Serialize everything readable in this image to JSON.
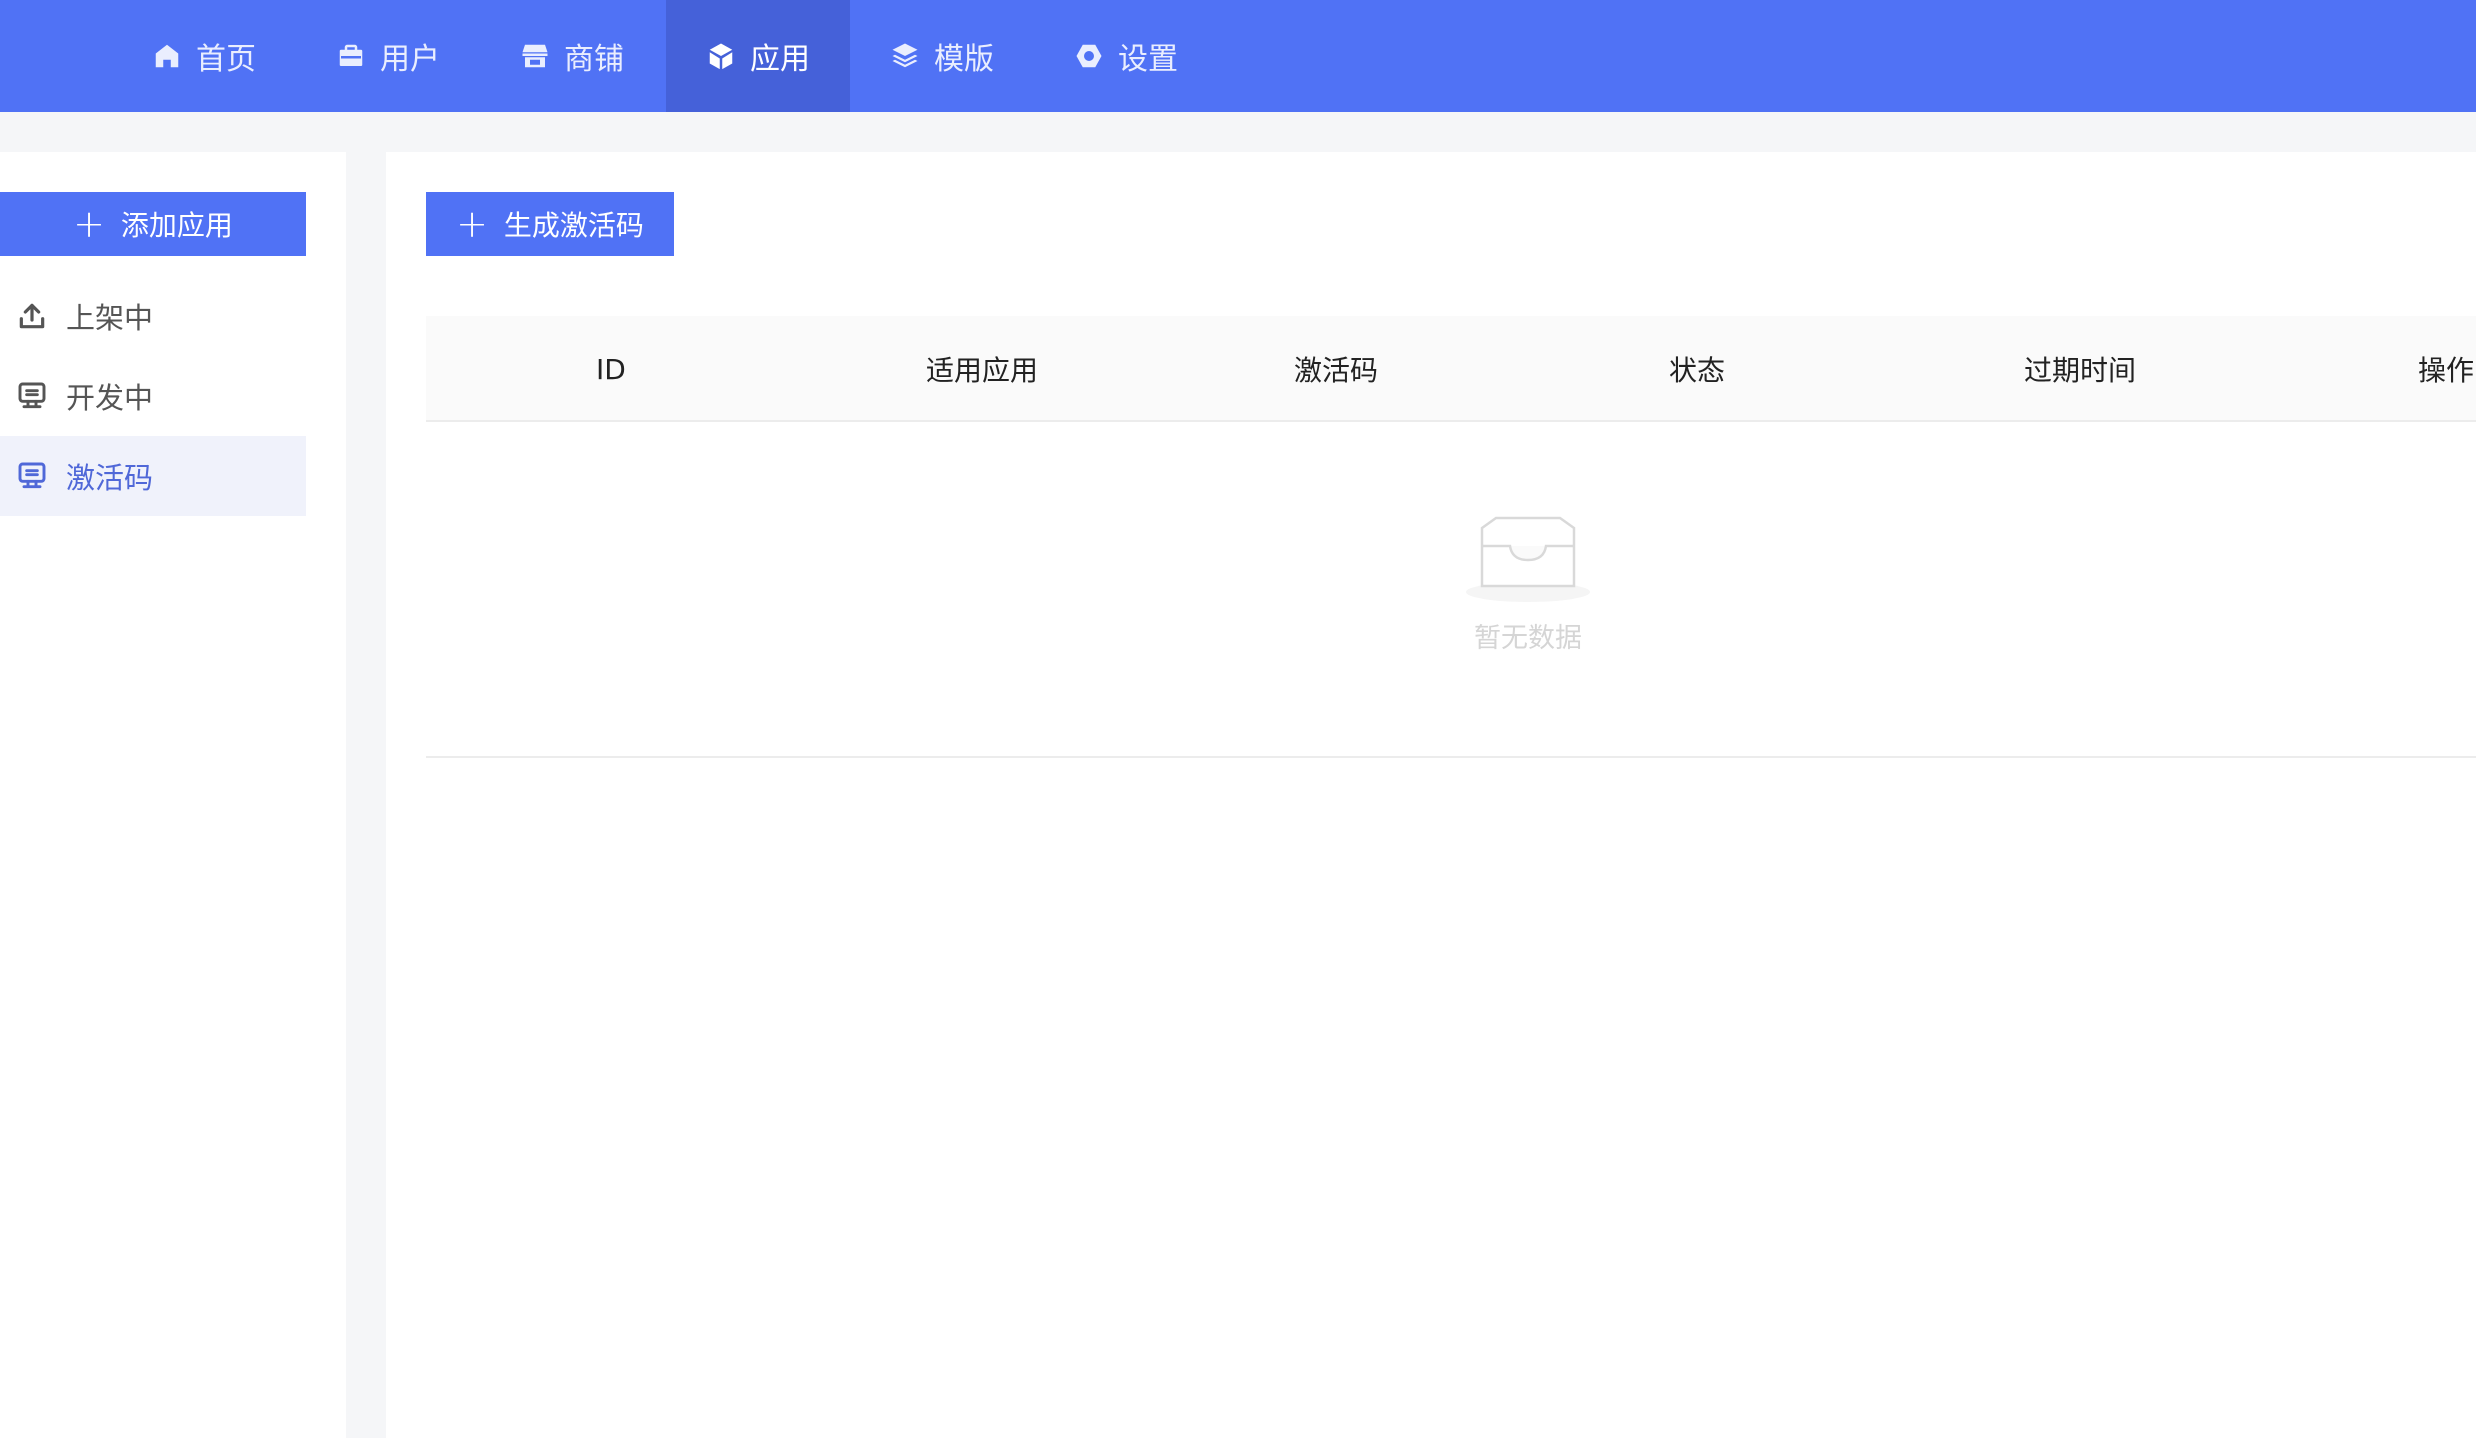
{
  "nav": {
    "items": [
      {
        "label": "首页",
        "icon": "home-icon"
      },
      {
        "label": "用户",
        "icon": "briefcase-icon"
      },
      {
        "label": "商铺",
        "icon": "store-icon"
      },
      {
        "label": "应用",
        "icon": "cube-icon",
        "active": true
      },
      {
        "label": "模版",
        "icon": "layers-icon"
      },
      {
        "label": "设置",
        "icon": "gear-icon"
      }
    ]
  },
  "sidebar": {
    "add_button": "添加应用",
    "items": [
      {
        "label": "上架中",
        "icon": "upload-icon"
      },
      {
        "label": "开发中",
        "icon": "monitor-icon"
      },
      {
        "label": "激活码",
        "icon": "monitor-icon",
        "active": true
      }
    ]
  },
  "main": {
    "generate_button": "生成激活码",
    "table": {
      "columns": [
        "ID",
        "适用应用",
        "激活码",
        "状态",
        "过期时间",
        "操作"
      ],
      "empty_text": "暂无数据"
    }
  },
  "colors": {
    "primary": "#5072f5",
    "nav_active": "#4561d9",
    "sidebar_active_bg": "#f0f2fb",
    "sidebar_active_text": "#5068d8"
  }
}
